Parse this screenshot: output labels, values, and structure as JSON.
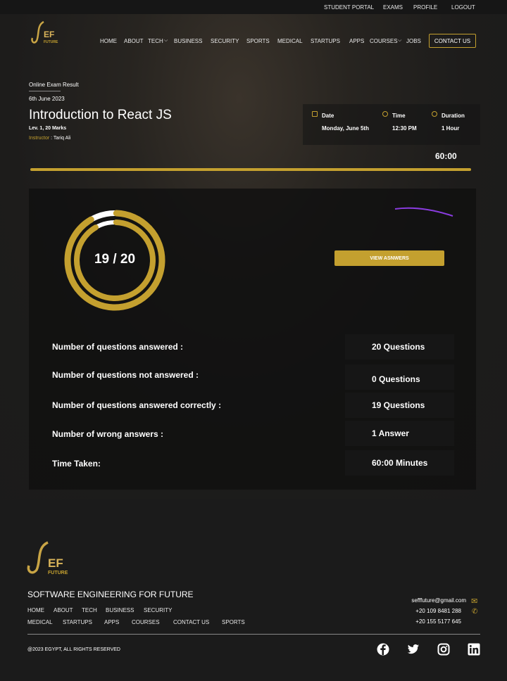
{
  "topbar": {
    "links": [
      "STUDENT PORTAL",
      "EXAMS",
      "PROFILE",
      "LOGOUT"
    ]
  },
  "brand": {
    "logo_text": "EF",
    "logo_sub": "FUTURE"
  },
  "nav": {
    "items": [
      "HOME",
      "ABOUT",
      "TECH",
      "BUSINESS",
      "SECURITY",
      "SPORTS",
      "MEDICAL",
      "STARTUPS",
      "APPS",
      "COURSES",
      "JOBS"
    ],
    "contact": "CONTACT US"
  },
  "exam": {
    "breadcrumb": "Online Exam Result",
    "date": "6th June 2023",
    "title": "Introduction to React JS",
    "level": "Lev. 1, 20 Marks",
    "instructor_label": "Instructor",
    "instructor": " : Tariq Ali",
    "info": [
      {
        "label": "Date",
        "value": "Monday, June 5th",
        "icon": "calendar-icon"
      },
      {
        "label": "Time",
        "value": "12:30 PM",
        "icon": "clock-icon"
      },
      {
        "label": "Duration",
        "value": "1 Hour",
        "icon": "stopwatch-icon"
      }
    ],
    "timer": "60:00",
    "progress_percent": 100
  },
  "result": {
    "score": "19 / 20",
    "correct": 19,
    "total": 20,
    "view_button": "VIEW ASNWERS",
    "stats": [
      {
        "label": "Number of questions answered :",
        "value": "20 Questions"
      },
      {
        "label": "Number of questions not answered :",
        "value": "0 Questions"
      },
      {
        "label": "Number of questions answered correctly :",
        "value": "19 Questions"
      },
      {
        "label": "Number of wrong answers :",
        "value": "1 Answer"
      },
      {
        "label": "Time Taken:",
        "value": "60:00 Minutes"
      }
    ]
  },
  "footer": {
    "tagline": "SOFTWARE ENGINEERING FOR FUTURE",
    "links_row1": [
      "HOME",
      "ABOUT",
      "TECH",
      "BUSINESS",
      "SECURITY"
    ],
    "links_row2": [
      "MEDICAL",
      "STARTUPS",
      "APPS",
      "COURSES",
      "CONTACT US",
      "SPORTS"
    ],
    "email": "sefffuture@gmail.com",
    "phone1": "+20 109 8481 288",
    "phone2": "+20 155 5177 645",
    "copyright": "@2023 EGYPT, ALL RIGHTS RESERVED",
    "social": [
      "facebook-icon",
      "twitter-icon",
      "instagram-icon",
      "linkedin-icon"
    ]
  },
  "colors": {
    "accent": "#c4a02f",
    "background": "#1b1b1b",
    "purple": "#8a3ce0"
  }
}
